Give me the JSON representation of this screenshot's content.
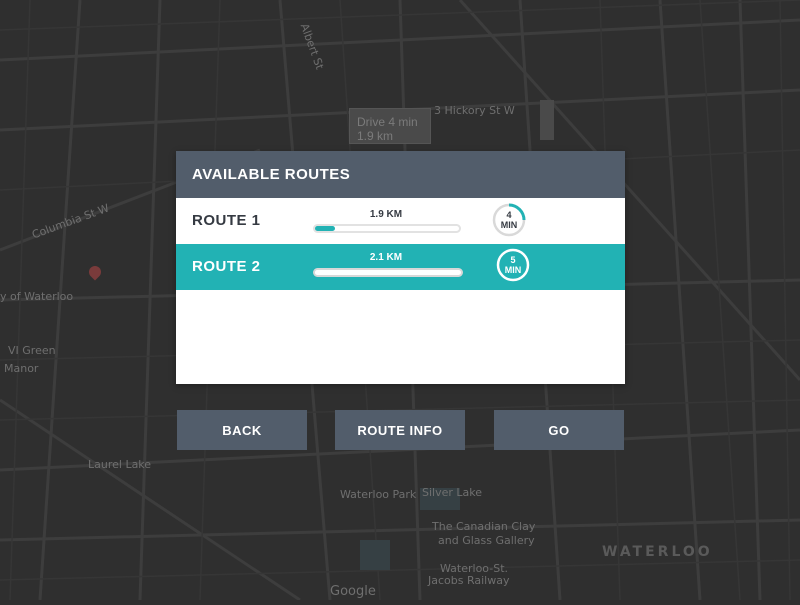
{
  "map": {
    "labels": {
      "albert_st": "Albert St",
      "hickory": "3 Hickory St W",
      "columbia": "Columbia St W",
      "waterloo_city": "y of Waterloo",
      "waterloo_park": "Waterloo Park",
      "silver_lake": "Silver Lake",
      "laurel_lake": "Laurel Lake",
      "canadian_clay_1": "The Canadian Clay",
      "canadian_clay_2": "and Glass Gallery",
      "jacobs_1": "Waterloo-St.",
      "jacobs_2": "Jacobs Railway",
      "waterloo_big": "WATERLOO",
      "vi_green": "VI Green",
      "manor": "Manor",
      "google": "Google"
    },
    "tooltip": {
      "line1": "Drive 4 min",
      "line2": "1.9 km"
    }
  },
  "dialog": {
    "title": "AVAILABLE ROUTES",
    "routes": [
      {
        "name": "ROUTE 1",
        "distance": "1.9 KM",
        "progress": 0.14,
        "time_value": "4",
        "time_unit": "MIN",
        "time_fraction": 0.25,
        "selected": false
      },
      {
        "name": "ROUTE 2",
        "distance": "2.1 KM",
        "progress": 0.1,
        "time_value": "5",
        "time_unit": "MIN",
        "time_fraction": 0.0,
        "selected": true
      }
    ]
  },
  "buttons": {
    "back": "BACK",
    "route_info": "ROUTE INFO",
    "go": "GO"
  },
  "colors": {
    "accent": "#22b2b4",
    "header": "#525d6b",
    "text_dark": "#353a42"
  }
}
